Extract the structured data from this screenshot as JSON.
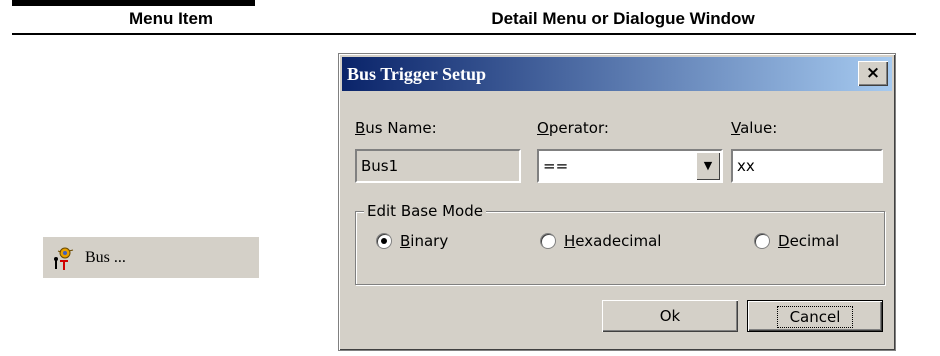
{
  "table": {
    "col1_header": "Menu Item",
    "col2_header": "Detail Menu or Dialogue Window"
  },
  "menu_item": {
    "icon": "bus-trigger-icon",
    "label": "Bus ..."
  },
  "dialog": {
    "title": "Bus Trigger Setup",
    "close_label": "×",
    "bus_name": {
      "label_mnemonic": "B",
      "label_rest": "us Name:",
      "value": "Bus1"
    },
    "operator": {
      "label_mnemonic": "O",
      "label_rest": "perator:",
      "value": "=="
    },
    "value": {
      "label_mnemonic": "V",
      "label_rest": "alue:",
      "value": "xx"
    },
    "base_mode": {
      "legend": "Edit Base Mode",
      "options": [
        {
          "mnemonic": "B",
          "rest": "inary",
          "selected": true
        },
        {
          "mnemonic": "H",
          "rest": "exadecimal",
          "selected": false
        },
        {
          "mnemonic": "D",
          "rest": "ecimal",
          "selected": false
        }
      ]
    },
    "ok_label": "Ok",
    "cancel_label": "Cancel"
  }
}
